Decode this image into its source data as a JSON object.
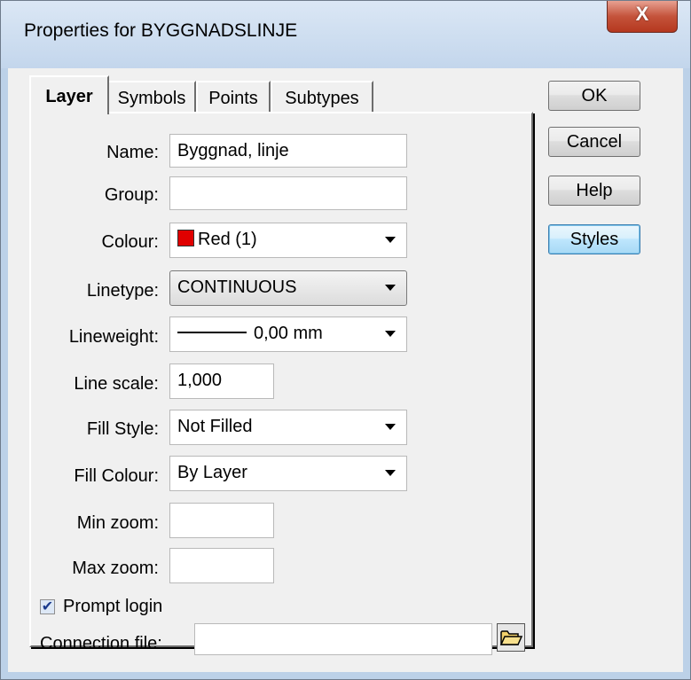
{
  "window": {
    "title": "Properties for BYGGNADSLINJE",
    "close_glyph": "X"
  },
  "tabs": [
    {
      "label": "Layer",
      "active": true
    },
    {
      "label": "Symbols",
      "active": false
    },
    {
      "label": "Points",
      "active": false
    },
    {
      "label": "Subtypes",
      "active": false
    }
  ],
  "form": {
    "name": {
      "label": "Name:",
      "value": "Byggnad, linje"
    },
    "group": {
      "label": "Group:",
      "value": ""
    },
    "colour": {
      "label": "Colour:",
      "value": "Red (1)",
      "swatch": "#e00000"
    },
    "linetype": {
      "label": "Linetype:",
      "value": "CONTINUOUS"
    },
    "lineweight": {
      "label": "Lineweight:",
      "value": "0,00 mm"
    },
    "line_scale": {
      "label": "Line scale:",
      "value": "1,000"
    },
    "fill_style": {
      "label": "Fill Style:",
      "value": "Not Filled"
    },
    "fill_colour": {
      "label": "Fill Colour:",
      "value": "By Layer"
    },
    "min_zoom": {
      "label": "Min zoom:",
      "value": ""
    },
    "max_zoom": {
      "label": "Max zoom:",
      "value": ""
    }
  },
  "buttons": {
    "ok": "OK",
    "cancel": "Cancel",
    "help": "Help",
    "styles": "Styles"
  },
  "prompt_login": {
    "label": "Prompt login",
    "checked": true
  },
  "connection_file": {
    "label": "Connection file:",
    "value": ""
  }
}
